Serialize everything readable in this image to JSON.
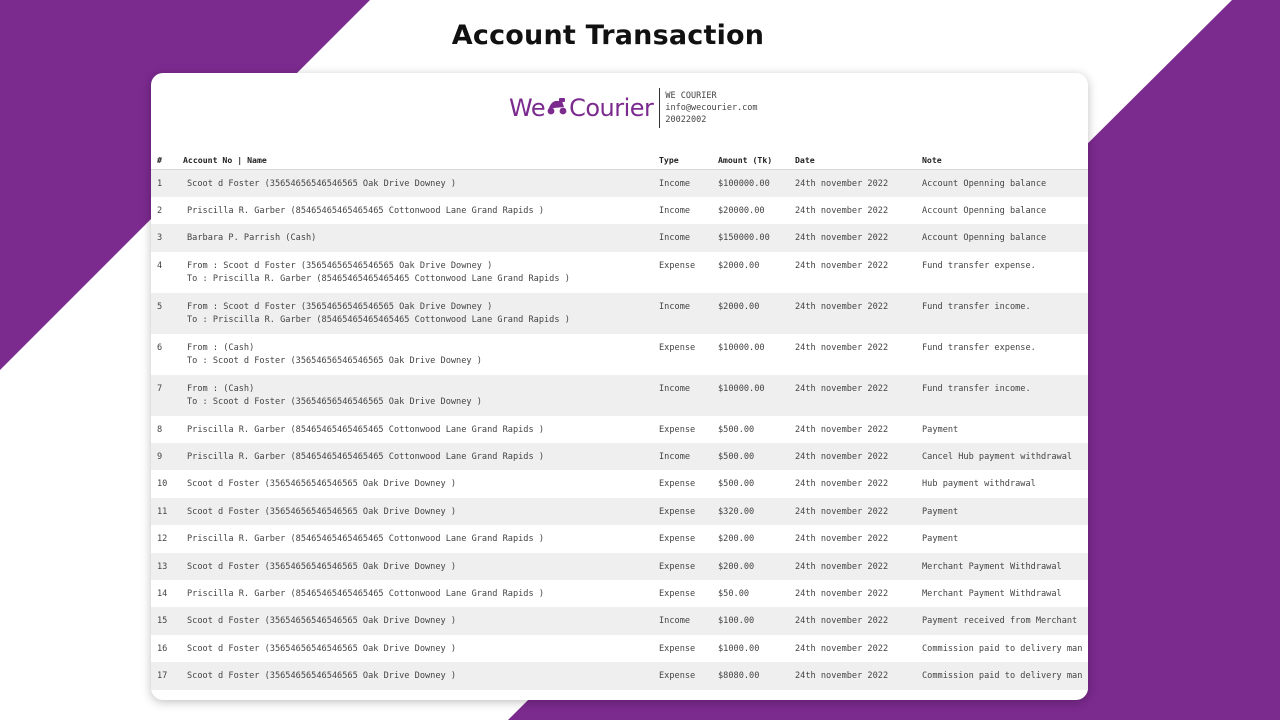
{
  "colors": {
    "brand_purple": "#7b2a8e",
    "background_purple": "#7b2a8e",
    "row_stripe": "#efefef"
  },
  "page": {
    "title": "Account Transaction"
  },
  "header": {
    "logo_left": "We",
    "logo_icon": "scooter-icon",
    "logo_right": "Courier",
    "company": "WE COURIER",
    "email": "info@wecourier.com",
    "phone": "20022002"
  },
  "table": {
    "columns": {
      "num": "#",
      "account": "Account No | Name",
      "type": "Type",
      "amount": "Amount (Tk)",
      "date": "Date",
      "note": "Note"
    },
    "rows": [
      {
        "num": "1",
        "lines": [
          "Scoot d Foster (35654656546546565 Oak Drive Downey )"
        ],
        "type": "Income",
        "amount": "$100000.00",
        "date": "24th november 2022",
        "note": "Account Openning balance"
      },
      {
        "num": "2",
        "lines": [
          "Priscilla R. Garber (85465465465465465 Cottonwood Lane Grand Rapids )"
        ],
        "type": "Income",
        "amount": "$20000.00",
        "date": "24th november 2022",
        "note": "Account Openning balance"
      },
      {
        "num": "3",
        "lines": [
          "Barbara P. Parrish (Cash)"
        ],
        "type": "Income",
        "amount": "$150000.00",
        "date": "24th november 2022",
        "note": "Account Openning balance"
      },
      {
        "num": "4",
        "lines": [
          "From : Scoot d Foster (35654656546546565 Oak Drive Downey )",
          "To : Priscilla R. Garber (85465465465465465 Cottonwood Lane Grand Rapids )"
        ],
        "type": "Expense",
        "amount": "$2000.00",
        "date": "24th november 2022",
        "note": "Fund transfer expense."
      },
      {
        "num": "5",
        "lines": [
          "From : Scoot d Foster (35654656546546565 Oak Drive Downey )",
          "To : Priscilla R. Garber (85465465465465465 Cottonwood Lane Grand Rapids )"
        ],
        "type": "Income",
        "amount": "$2000.00",
        "date": "24th november 2022",
        "note": "Fund transfer income."
      },
      {
        "num": "6",
        "lines": [
          "From : (Cash)",
          "To : Scoot d Foster (35654656546546565 Oak Drive Downey )"
        ],
        "type": "Expense",
        "amount": "$10000.00",
        "date": "24th november 2022",
        "note": "Fund transfer expense."
      },
      {
        "num": "7",
        "lines": [
          "From : (Cash)",
          "To : Scoot d Foster (35654656546546565 Oak Drive Downey )"
        ],
        "type": "Income",
        "amount": "$10000.00",
        "date": "24th november 2022",
        "note": "Fund transfer income."
      },
      {
        "num": "8",
        "lines": [
          "Priscilla R. Garber (85465465465465465 Cottonwood Lane Grand Rapids )"
        ],
        "type": "Expense",
        "amount": "$500.00",
        "date": "24th november 2022",
        "note": "Payment"
      },
      {
        "num": "9",
        "lines": [
          "Priscilla R. Garber (85465465465465465 Cottonwood Lane Grand Rapids )"
        ],
        "type": "Income",
        "amount": "$500.00",
        "date": "24th november 2022",
        "note": "Cancel Hub payment withdrawal"
      },
      {
        "num": "10",
        "lines": [
          "Scoot d Foster (35654656546546565 Oak Drive Downey )"
        ],
        "type": "Expense",
        "amount": "$500.00",
        "date": "24th november 2022",
        "note": "Hub payment withdrawal"
      },
      {
        "num": "11",
        "lines": [
          "Scoot d Foster (35654656546546565 Oak Drive Downey )"
        ],
        "type": "Expense",
        "amount": "$320.00",
        "date": "24th november 2022",
        "note": "Payment"
      },
      {
        "num": "12",
        "lines": [
          "Priscilla R. Garber (85465465465465465 Cottonwood Lane Grand Rapids )"
        ],
        "type": "Expense",
        "amount": "$200.00",
        "date": "24th november 2022",
        "note": "Payment"
      },
      {
        "num": "13",
        "lines": [
          "Scoot d Foster (35654656546546565 Oak Drive Downey )"
        ],
        "type": "Expense",
        "amount": "$200.00",
        "date": "24th november 2022",
        "note": "Merchant Payment Withdrawal"
      },
      {
        "num": "14",
        "lines": [
          "Priscilla R. Garber (85465465465465465 Cottonwood Lane Grand Rapids )"
        ],
        "type": "Expense",
        "amount": "$50.00",
        "date": "24th november 2022",
        "note": "Merchant Payment Withdrawal"
      },
      {
        "num": "15",
        "lines": [
          "Scoot d Foster (35654656546546565 Oak Drive Downey )"
        ],
        "type": "Income",
        "amount": "$100.00",
        "date": "24th november 2022",
        "note": "Payment received from Merchant"
      },
      {
        "num": "16",
        "lines": [
          "Scoot d Foster (35654656546546565 Oak Drive Downey )"
        ],
        "type": "Expense",
        "amount": "$1000.00",
        "date": "24th november 2022",
        "note": "Commission paid to delivery man"
      },
      {
        "num": "17",
        "lines": [
          "Scoot d Foster (35654656546546565 Oak Drive Downey )"
        ],
        "type": "Expense",
        "amount": "$8080.00",
        "date": "24th november 2022",
        "note": "Commission paid to delivery man"
      }
    ]
  }
}
